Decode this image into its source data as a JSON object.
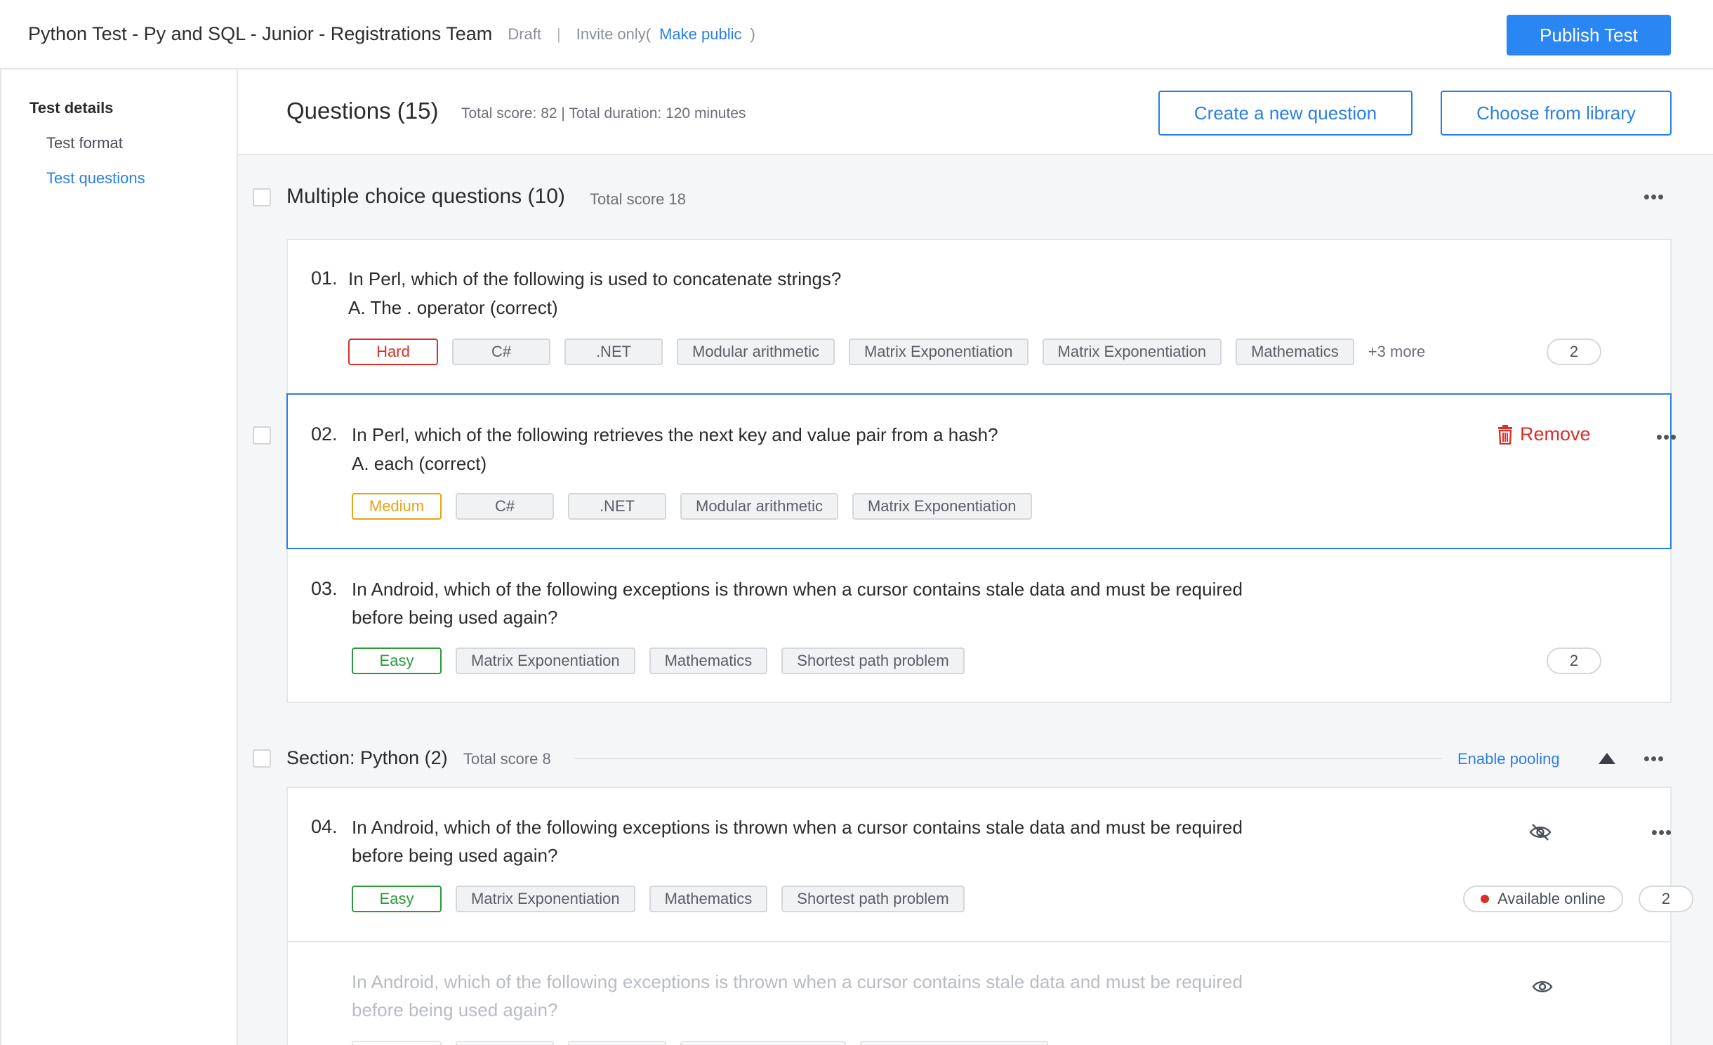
{
  "header": {
    "title": "Python Test - Py and SQL - Junior - Registrations Team",
    "status": "Draft",
    "separator": "|",
    "invite": "Invite only",
    "paren_open": "(",
    "make_public": "Make public",
    "paren_close": ")",
    "publish_label": "Publish Test"
  },
  "sidebar": {
    "group": "Test details",
    "items": [
      {
        "label": "Test format",
        "active": false
      },
      {
        "label": "Test questions",
        "active": true
      }
    ]
  },
  "questions_header": {
    "title": "Questions (15)",
    "summary": "Total score: 82 | Total duration: 120 minutes",
    "create_label": "Create a new question",
    "library_label": "Choose from library"
  },
  "mcq_section": {
    "title": "Multiple choice questions (10)",
    "score": "Total score 18",
    "questions": [
      {
        "num": "01.",
        "text": "In Perl, which of the following is used to concatenate strings?",
        "answer": "A. The . operator (correct)",
        "level": "Hard",
        "tags": [
          "C#",
          ".NET",
          "Modular arithmetic",
          "Matrix Exponentiation",
          "Matrix Exponentiation",
          "Mathematics"
        ],
        "more": "+3 more",
        "score": "2"
      },
      {
        "num": "02.",
        "text": "In Perl, which of the following retrieves the next key and value pair from a hash?",
        "answer": "A. each (correct)",
        "level": "Medium",
        "tags": [
          "C#",
          ".NET",
          "Modular arithmetic",
          "Matrix Exponentiation"
        ],
        "remove_label": "Remove"
      },
      {
        "num": "03.",
        "text": "In Android, which of the following exceptions is thrown when a cursor contains stale data and must be required before being used again?",
        "level": "Easy",
        "tags": [
          "Matrix Exponentiation",
          "Mathematics",
          "Shortest path problem"
        ],
        "score": "2"
      }
    ]
  },
  "python_section": {
    "title": "Section: Python (2)",
    "score": "Total score 8",
    "pooling_label": "Enable pooling",
    "questions": [
      {
        "num": "04.",
        "text": "In Android, which of the following exceptions is thrown when a cursor contains stale data and must be required before being used again?",
        "level": "Easy",
        "tags": [
          "Matrix Exponentiation",
          "Mathematics",
          "Shortest path problem"
        ],
        "availability": "Available online",
        "score": "2"
      },
      {
        "text": "In Android, which of the following exceptions is thrown when a cursor contains stale data and must be required before being used again?"
      }
    ]
  },
  "colors": {
    "accent": "#2a86f2",
    "hard": "#d9302a",
    "medium": "#e6a312",
    "easy": "#2a9a3c"
  },
  "icons": [
    "trash-icon",
    "more-icon",
    "caret-up-icon",
    "eye-off-icon",
    "eye-icon",
    "status-dot-icon"
  ]
}
